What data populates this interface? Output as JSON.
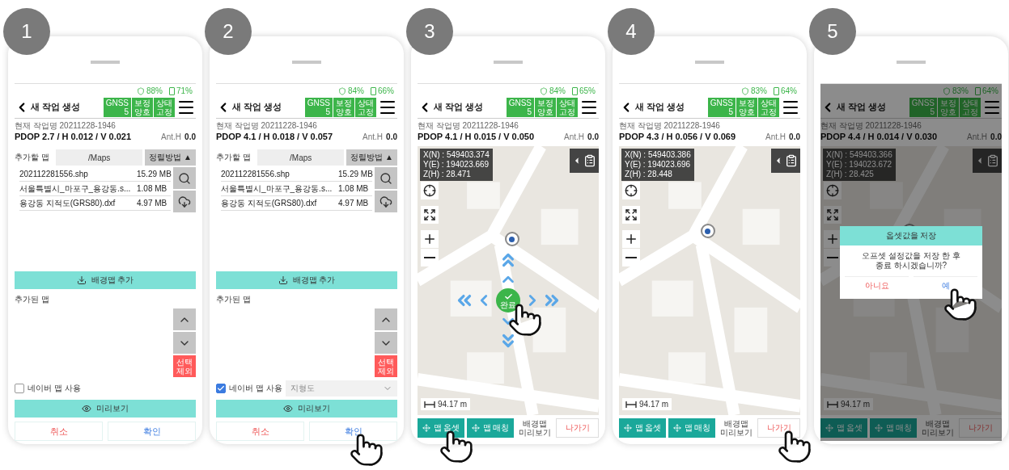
{
  "steps": [
    {
      "number": "1",
      "kind": "map_list",
      "status": {
        "signal": "88%",
        "battery": "71%"
      },
      "header": {
        "title": "새 작업 생성",
        "gnss": [
          {
            "label": "GNSS",
            "value": "5"
          },
          {
            "label": "보정",
            "value": "양호"
          },
          {
            "label": "상태",
            "value": "고정"
          }
        ],
        "job": "현재 작업명 20211228-1946",
        "precision": "PDOP 2.7 / H 0.012 / V 0.021",
        "ant_label": "Ant.H",
        "ant_value": "0.0"
      },
      "list": {
        "label": "추가할 맵",
        "path": "/Maps",
        "sort": "정렬방법",
        "sort_arrow": "▲",
        "files": [
          {
            "name": "202112281556.shp",
            "size": "15.29 MB"
          },
          {
            "name": "서울특별시_마포구_용강동.s...",
            "size": "1.08 MB"
          },
          {
            "name": "용강동 지적도(GRS80).dxf",
            "size": "4.97 MB"
          }
        ],
        "add_button": "배경맵 추가",
        "added_label": "추가된 맵",
        "remove_lines": [
          "선택",
          "제외"
        ],
        "naver": {
          "label": "네이버 맵 사용",
          "checked": false
        },
        "preview_button": "미리보기",
        "cancel": {
          "label": "취소",
          "touched": false
        },
        "confirm": {
          "label": "확인",
          "touched": false
        }
      }
    },
    {
      "number": "2",
      "kind": "map_list",
      "status": {
        "signal": "84%",
        "battery": "66%"
      },
      "header": {
        "title": "새 작업 생성",
        "gnss": [
          {
            "label": "GNSS",
            "value": "5"
          },
          {
            "label": "보정",
            "value": "양호"
          },
          {
            "label": "상태",
            "value": "고정"
          }
        ],
        "job": "현재 작업명 20211228-1946",
        "precision": "PDOP 4.1 / H 0.018 / V 0.057",
        "ant_label": "Ant.H",
        "ant_value": "0.0"
      },
      "list": {
        "label": "추가할 맵",
        "path": "/Maps",
        "sort": "정렬방법",
        "sort_arrow": "▲",
        "files": [
          {
            "name": "202112281556.shp",
            "size": "15.29 MB"
          },
          {
            "name": "서울특별시_마포구_용강동.s...",
            "size": "1.08 MB"
          },
          {
            "name": "용강동 지적도(GRS80).dxf",
            "size": "4.97 MB"
          }
        ],
        "add_button": "배경맵 추가",
        "added_label": "추가된 맵",
        "remove_lines": [
          "선택",
          "제외"
        ],
        "naver": {
          "label": "네이버 맵 사용",
          "checked": true,
          "map_type": "지형도"
        },
        "preview_button": "미리보기",
        "cancel": {
          "label": "취소",
          "touched": false
        },
        "confirm": {
          "label": "확인",
          "touched": true
        }
      }
    },
    {
      "number": "3",
      "kind": "map",
      "status": {
        "signal": "84%",
        "battery": "65%"
      },
      "header": {
        "title": "새 작업 생성",
        "gnss": [
          {
            "label": "GNSS",
            "value": "5"
          },
          {
            "label": "보정",
            "value": "양호"
          },
          {
            "label": "상태",
            "value": "고정"
          }
        ],
        "job": "현재 작업명 20211228-1946",
        "precision": "PDOP 4.1 / H 0.015 / V 0.050",
        "ant_label": "Ant.H",
        "ant_value": "0.0"
      },
      "map": {
        "coords": [
          "X(N) : 549403.374",
          "Y(E) : 194023.669",
          "Z(H) : 28.471"
        ],
        "scale": "94.17 m",
        "nudge": {
          "label": "완료",
          "touched": true
        },
        "offset_button": {
          "label": "맵 옵셋",
          "touched": true
        },
        "match_button": {
          "label": "맵 매칭",
          "touched": false
        },
        "preview_lines": [
          "배경맵",
          "미리보기"
        ],
        "exit": {
          "label": "나가기",
          "touched": false
        }
      }
    },
    {
      "number": "4",
      "kind": "map",
      "status": {
        "signal": "83%",
        "battery": "64%"
      },
      "header": {
        "title": "새 작업 생성",
        "gnss": [
          {
            "label": "GNSS",
            "value": "5"
          },
          {
            "label": "보정",
            "value": "양호"
          },
          {
            "label": "상태",
            "value": "고정"
          }
        ],
        "job": "현재 작업명 20211228-1946",
        "precision": "PDOP 4.3 / H 0.056 / V 0.069",
        "ant_label": "Ant.H",
        "ant_value": "0.0"
      },
      "map": {
        "coords": [
          "X(N) : 549403.386",
          "Y(E) : 194023.696",
          "Z(H) : 28.448"
        ],
        "scale": "94.17 m",
        "offset_button": {
          "label": "맵 옵셋",
          "touched": false
        },
        "match_button": {
          "label": "맵 매칭",
          "touched": false
        },
        "preview_lines": [
          "배경맵",
          "미리보기"
        ],
        "exit": {
          "label": "나가기",
          "touched": true
        }
      }
    },
    {
      "number": "5",
      "kind": "map",
      "status": {
        "signal": "83%",
        "battery": "64%"
      },
      "header": {
        "title": "새 작업 생성",
        "gnss": [
          {
            "label": "GNSS",
            "value": "5"
          },
          {
            "label": "보정",
            "value": "양호"
          },
          {
            "label": "상태",
            "value": "고정"
          }
        ],
        "job": "현재 작업명 20211228-1946",
        "precision": "PDOP 4.4 / H 0.014 / V 0.030",
        "ant_label": "Ant.H",
        "ant_value": "0.0"
      },
      "map": {
        "coords": [
          "X(N) : 549403.366",
          "Y(E) : 194023.672",
          "Z(H) : 28.425"
        ],
        "scale": "94.17 m",
        "offset_button": {
          "label": "맵 옵셋",
          "touched": false
        },
        "match_button": {
          "label": "맵 매칭",
          "touched": false
        },
        "preview_lines": [
          "배경맵",
          "미리보기"
        ],
        "exit": {
          "label": "나가기",
          "touched": false
        }
      },
      "dialog": {
        "title": "옵셋값을 저장",
        "message": [
          "오프셋 설정값을 저장 한 후",
          "종료 하시겠습니까?"
        ],
        "no": {
          "label": "아니요",
          "touched": false
        },
        "yes": {
          "label": "예",
          "touched": true
        }
      }
    }
  ]
}
